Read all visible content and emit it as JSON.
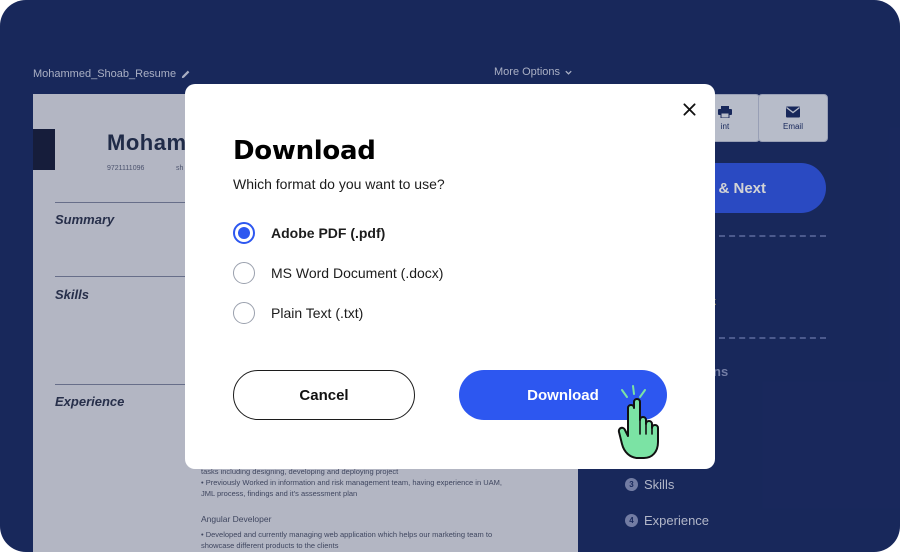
{
  "document": {
    "filename": "Mohammed_Shoab_Resume",
    "more_options": "More Options"
  },
  "resume_preview": {
    "name": "Moham",
    "phone": "9721111096",
    "contact_fragment": "sh",
    "sections": [
      "Summary",
      "Skills",
      "Experience"
    ],
    "experience_lines": [
      "tasks including designing, developing and deploying project",
      "• Previously Worked in information and risk management team, having experience in UAM,",
      "  JML process, findings and it's assessment plan",
      "Angular Developer",
      "• Developed and currently managing web application which helps our marketing team to",
      "  showcase different products to the clients"
    ]
  },
  "right_panel": {
    "print_label": "int",
    "email_label": "Email",
    "next_label": "& Next",
    "partial_1": "k",
    "partial_2": "ns",
    "steps": [
      {
        "num": "3",
        "label": "Skills"
      },
      {
        "num": "4",
        "label": "Experience"
      }
    ]
  },
  "modal": {
    "title": "Download",
    "subtitle": "Which format do you want to use?",
    "options": [
      {
        "label": "Adobe PDF (.pdf)",
        "selected": true
      },
      {
        "label": "MS Word Document (.docx)",
        "selected": false
      },
      {
        "label": "Plain Text (.txt)",
        "selected": false
      }
    ],
    "cancel_label": "Cancel",
    "download_label": "Download"
  },
  "colors": {
    "background_navy": "#1d2f6b",
    "accent_blue": "#2d57f0",
    "cursor_green": "#7be3a4"
  },
  "icons": {
    "close": "close-icon",
    "edit": "pencil-icon",
    "chevron": "chevron-down-icon",
    "print": "printer-icon",
    "email": "envelope-icon",
    "cursor": "hand-pointer-icon"
  }
}
